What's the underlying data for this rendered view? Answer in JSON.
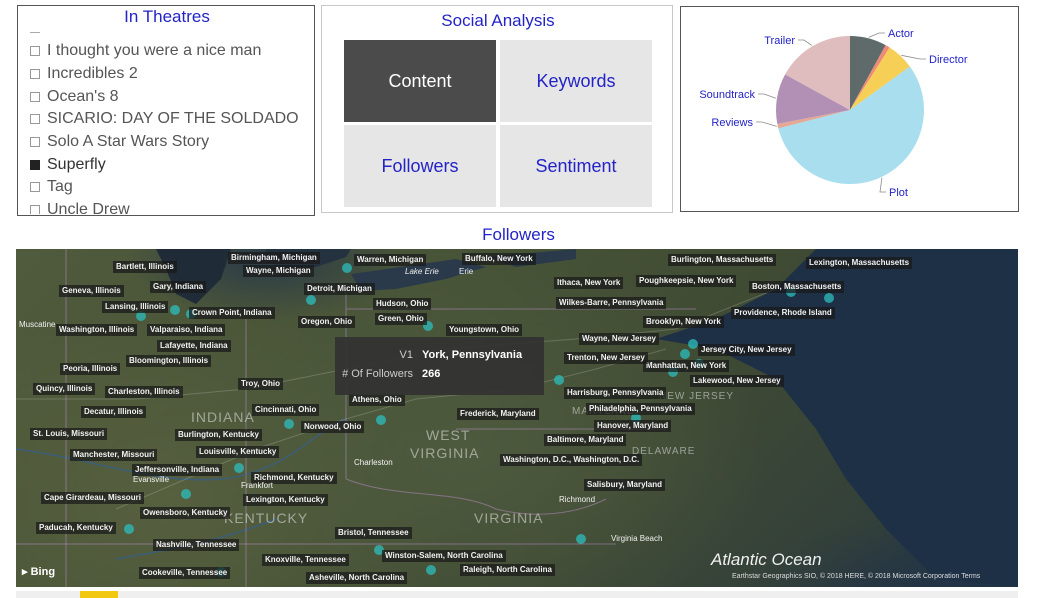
{
  "theatres": {
    "title": "In Theatres",
    "items": [
      {
        "label": "I thought you were a nice man",
        "selected": false
      },
      {
        "label": "Incredibles 2",
        "selected": false
      },
      {
        "label": "Ocean's 8",
        "selected": false
      },
      {
        "label": "SICARIO: DAY OF THE SOLDADO",
        "selected": false
      },
      {
        "label": "Solo A Star Wars Story",
        "selected": false
      },
      {
        "label": "Superfly",
        "selected": true
      },
      {
        "label": "Tag",
        "selected": false
      },
      {
        "label": "Uncle Drew",
        "selected": false
      }
    ]
  },
  "social": {
    "title": "Social Analysis",
    "tiles": {
      "content": "Content",
      "keywords": "Keywords",
      "followers": "Followers",
      "sentiment": "Sentiment"
    },
    "active": "Content"
  },
  "chart_data": {
    "type": "pie",
    "title": "",
    "slices": [
      {
        "label": "Actor",
        "value": 8,
        "color": "#5f6b6b"
      },
      {
        "label": "",
        "value": 1,
        "color": "#ef8a78"
      },
      {
        "label": "Director",
        "value": 6,
        "color": "#f5cf56"
      },
      {
        "label": "Plot",
        "value": 56,
        "color": "#a8deee"
      },
      {
        "label": "Reviews",
        "value": 1,
        "color": "#e3a896"
      },
      {
        "label": "Soundtrack",
        "value": 11,
        "color": "#b28fb4"
      },
      {
        "label": "Trailer",
        "value": 17,
        "color": "#dfbcbe"
      }
    ],
    "legend": "callout labels"
  },
  "map": {
    "title": "Followers",
    "tooltip": {
      "k1": "V1",
      "v1": "York, Pennsylvania",
      "k2": "# Of Followers",
      "v2": "266"
    },
    "ocean_label": "Atlantic Ocean",
    "bing": "Bing",
    "copyright": "Earthstar Geographics SIO, © 2018 HERE, © 2018 Microsoft Corporation  Terms",
    "states": [
      "INDIANA",
      "WEST",
      "VIRGINIA",
      "KENTUCKY",
      "VIRGINIA",
      "NEW JERSEY",
      "DELAWARE",
      "MARYLAND"
    ],
    "cities": [
      "Bartlett, Illinois",
      "Birmingham, Michigan",
      "Wayne, Michigan",
      "Warren, Michigan",
      "Buffalo, New York",
      "Burlington, Massachusetts",
      "Lexington, Massachusetts",
      "Geneva, Illinois",
      "Gary, Indiana",
      "Detroit, Michigan",
      "Lake Erie",
      "Erie",
      "Ithaca, New York",
      "Poughkeepsie, New York",
      "Boston, Massachusetts",
      "Lansing, Illinois",
      "Crown Point, Indiana",
      "Hudson, Ohio",
      "Wilkes-Barre, Pennsylvania",
      "Providence, Rhode Island",
      "Washington, Illinois",
      "Valparaiso, Indiana",
      "Oregon, Ohio",
      "Green, Ohio",
      "Brooklyn, New York",
      "Muscatine",
      "Youngstown, Ohio",
      "Wayne, New Jersey",
      "Lafayette, Indiana",
      "Jersey City, New Jersey",
      "Bloomington, Illinois",
      "Peoria, Illinois",
      "Manhattan, New York",
      "Trenton, New Jersey",
      "Quincy, Illinois",
      "Charleston, Illinois",
      "Troy, Ohio",
      "Lakewood, New Jersey",
      "Athens, Ohio",
      "Harrisburg, Pennsylvania",
      "Decatur, Illinois",
      "Cincinnati, Ohio",
      "Philadelphia, Pennsylvania",
      "Frederick, Maryland",
      "Hanover, Maryland",
      "Norwood, Ohio",
      "St. Louis, Missouri",
      "Burlington, Kentucky",
      "Baltimore, Maryland",
      "Manchester, Missouri",
      "Louisville, Kentucky",
      "Washington, D.C., Washington, D.C.",
      "Jeffersonville, Indiana",
      "Richmond, Kentucky",
      "Charleston",
      "Salisbury, Maryland",
      "Cape Girardeau, Missouri",
      "Lexington, Kentucky",
      "Richmond",
      "Owensboro, Kentucky",
      "Paducah, Kentucky",
      "Bristol, Tennessee",
      "Virginia Beach",
      "Nashville, Tennessee",
      "Winston-Salem, North Carolina",
      "Knoxville, Tennessee",
      "Cookeville, Tennessee",
      "Asheville, North Carolina",
      "Raleigh, North Carolina",
      "Evansville",
      "Frankfort"
    ]
  }
}
